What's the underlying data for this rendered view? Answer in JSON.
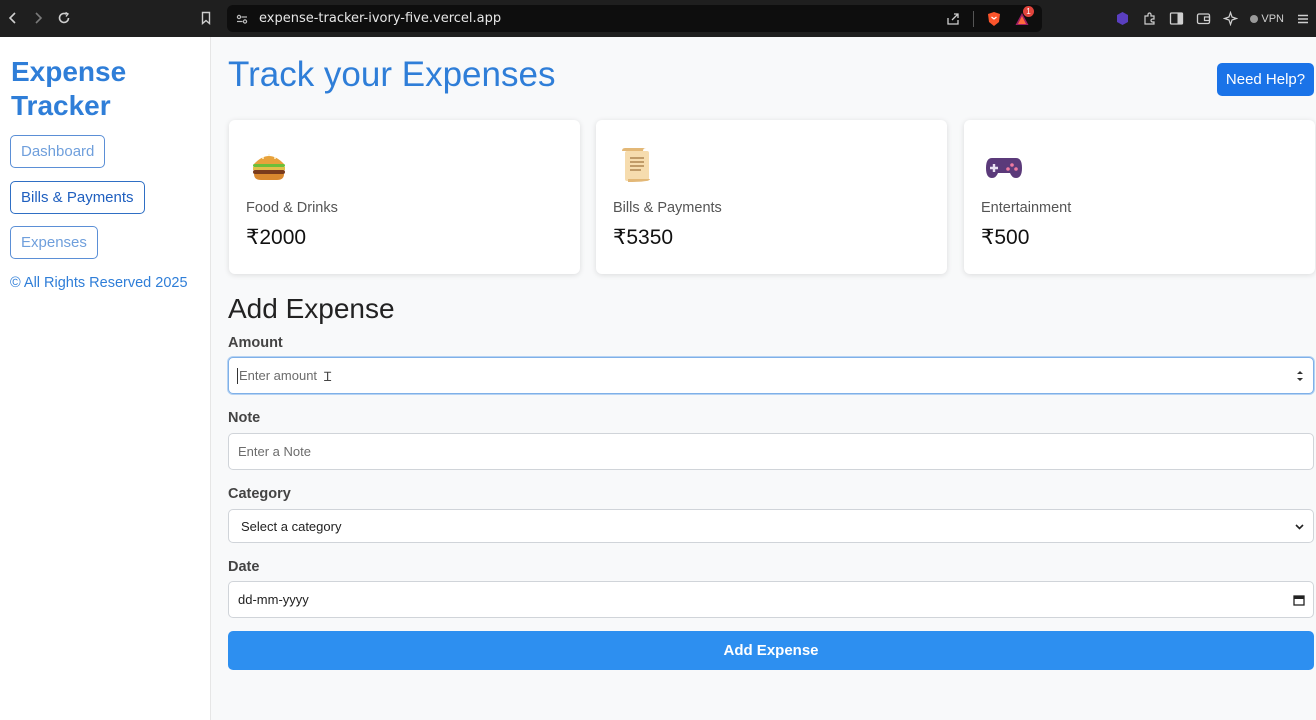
{
  "browser": {
    "url": "expense-tracker-ivory-five.vercel.app",
    "vpn_label": "VPN",
    "badge_count": "1"
  },
  "sidebar": {
    "brand": "Expense Tracker",
    "items": [
      {
        "label": "Dashboard"
      },
      {
        "label": "Bills & Payments"
      },
      {
        "label": "Expenses"
      }
    ],
    "copyright": "© All Rights Reserved 2025"
  },
  "main": {
    "title": "Track your Expenses",
    "help_label": "Need Help?",
    "cards": [
      {
        "icon": "burger-icon",
        "label": "Food & Drinks",
        "amount": "₹2000"
      },
      {
        "icon": "scroll-icon",
        "label": "Bills & Payments",
        "amount": "₹5350"
      },
      {
        "icon": "gamepad-icon",
        "label": "Entertainment",
        "amount": "₹500"
      }
    ],
    "form": {
      "title": "Add Expense",
      "amount_label": "Amount",
      "amount_placeholder": "Enter amount",
      "note_label": "Note",
      "note_placeholder": "Enter a Note",
      "category_label": "Category",
      "category_value": "Select a category",
      "date_label": "Date",
      "date_value": "dd-mm-yyyy",
      "submit_label": "Add Expense"
    }
  },
  "colors": {
    "brand": "#2f7ed8",
    "primary_button": "#2d8ff0",
    "help_button": "#1a73e8"
  }
}
